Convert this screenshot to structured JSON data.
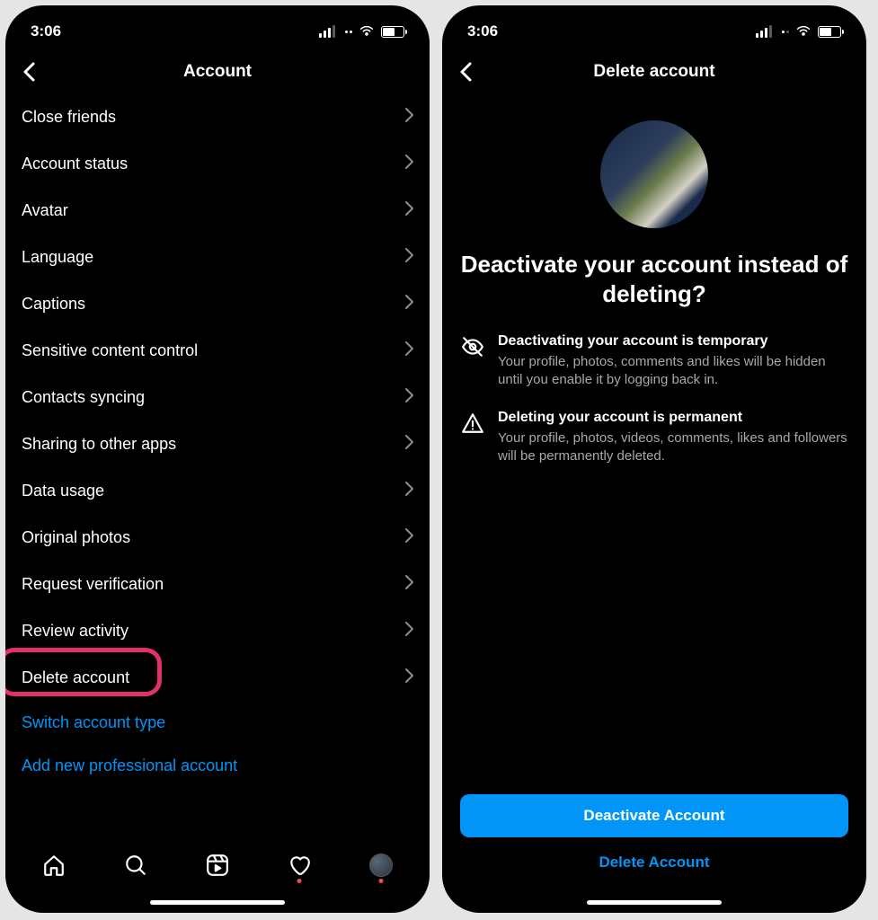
{
  "status": {
    "time": "3:06"
  },
  "left": {
    "title": "Account",
    "menu": [
      {
        "label": "Close friends"
      },
      {
        "label": "Account status"
      },
      {
        "label": "Avatar"
      },
      {
        "label": "Language"
      },
      {
        "label": "Captions"
      },
      {
        "label": "Sensitive content control"
      },
      {
        "label": "Contacts syncing"
      },
      {
        "label": "Sharing to other apps"
      },
      {
        "label": "Data usage"
      },
      {
        "label": "Original photos"
      },
      {
        "label": "Request verification"
      },
      {
        "label": "Review activity"
      },
      {
        "label": "Delete account"
      }
    ],
    "links": [
      {
        "label": "Switch account type"
      },
      {
        "label": "Add new professional account"
      }
    ],
    "highlighted_item_index": 12
  },
  "right": {
    "title": "Delete account",
    "heading": "Deactivate your account instead of deleting?",
    "sections": [
      {
        "icon": "eye-off",
        "title": "Deactivating your account is temporary",
        "body": "Your profile, photos, comments and likes will be hidden until you enable it by logging back in."
      },
      {
        "icon": "warning",
        "title": "Deleting your account is permanent",
        "body": "Your profile, photos, videos, comments, likes and followers will be permanently deleted."
      }
    ],
    "primary_button": "Deactivate Account",
    "secondary_link": "Delete Account"
  }
}
